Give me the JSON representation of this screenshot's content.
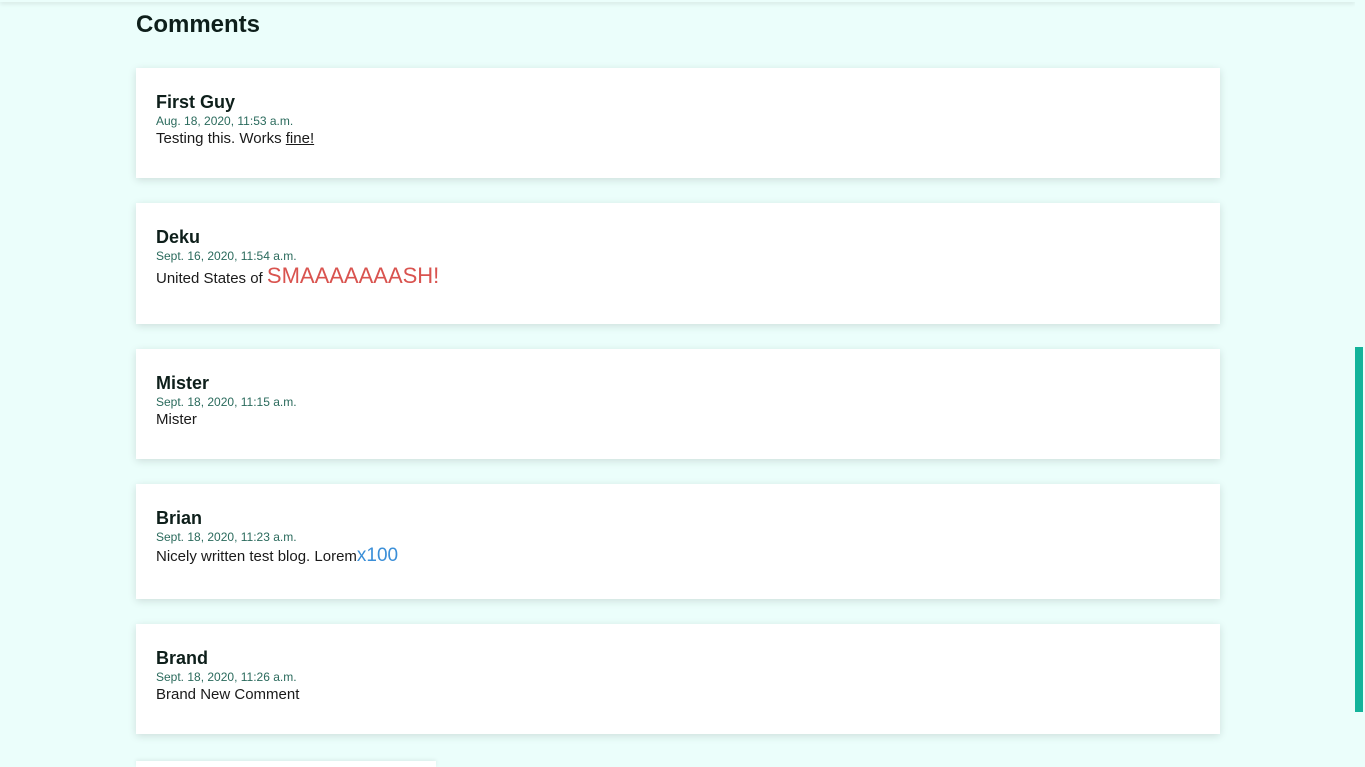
{
  "section": {
    "title": "Comments"
  },
  "comments": [
    {
      "author": "First Guy",
      "date": "Aug. 18, 2020, 11:53 a.m.",
      "body_prefix": "Testing this. Works ",
      "body_underlined": "fine!"
    },
    {
      "author": "Deku",
      "date": "Sept. 16, 2020, 11:54 a.m.",
      "body_prefix": "United States of ",
      "body_red": "SMAAAAAAASH!"
    },
    {
      "author": "Mister",
      "date": "Sept. 18, 2020, 11:15 a.m.",
      "body": "Mister"
    },
    {
      "author": "Brian",
      "date": "Sept. 18, 2020, 11:23 a.m.",
      "body_prefix": "Nicely written test blog. Lorem",
      "body_blue": "x100"
    },
    {
      "author": "Brand",
      "date": "Sept. 18, 2020, 11:26 a.m.",
      "body": "Brand New Comment"
    }
  ],
  "colors": {
    "background": "#ebfefb",
    "card": "#ffffff",
    "accent_red": "#d9534f",
    "accent_blue": "#3b8fd8",
    "scrollbar": "#13b39a",
    "date_text": "#2a6a5c"
  }
}
